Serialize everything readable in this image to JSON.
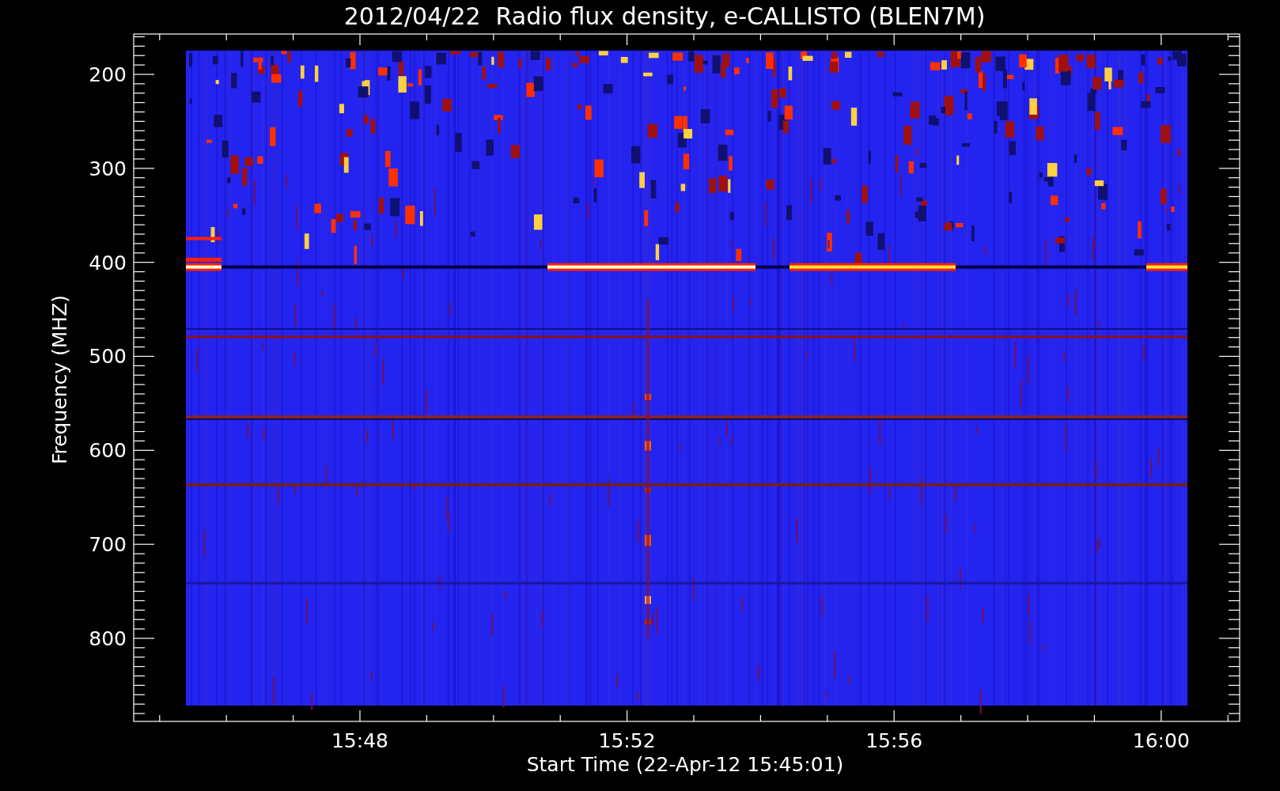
{
  "title": "2012/04/22  Radio flux density, e-CALLISTO (BLEN7M)",
  "xlabel": "Start Time (22-Apr-12 15:45:01)",
  "ylabel": "Frequency (MHZ)",
  "xticks": [
    "15:48",
    "15:52",
    "15:56",
    "16:00"
  ],
  "yticks": [
    "200",
    "300",
    "400",
    "500",
    "600",
    "700",
    "800"
  ]
}
